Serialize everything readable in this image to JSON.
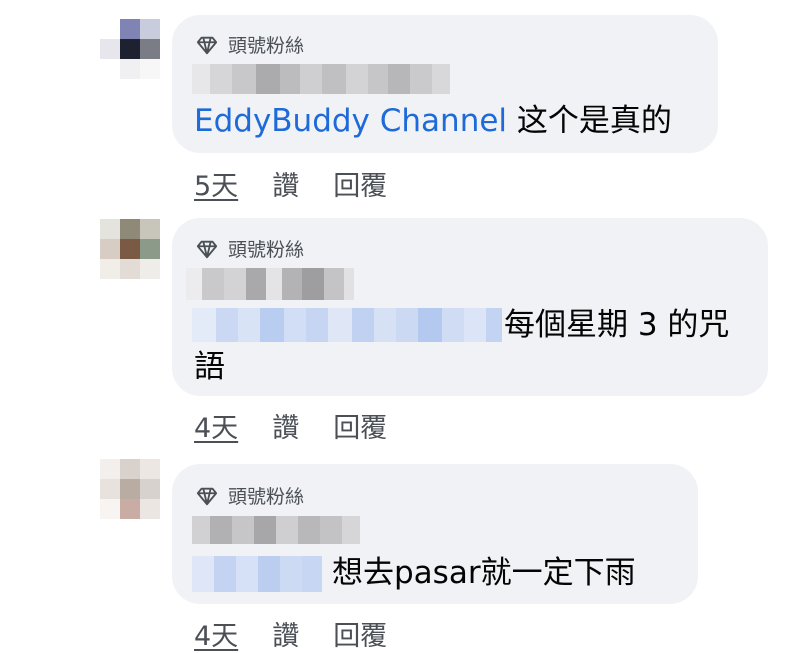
{
  "comments": [
    {
      "badge": "頭號粉絲",
      "mention": "EddyBuddy Channel",
      "text": "这个是真的",
      "time": "5天",
      "like": "讚",
      "reply": "回覆"
    },
    {
      "badge": "頭號粉絲",
      "text_line1": "每個星期 3 的咒",
      "text_line2": "語",
      "time": "4天",
      "like": "讚",
      "reply": "回覆"
    },
    {
      "badge": "頭號粉絲",
      "text": "想去pasar就一定下雨",
      "time": "4天",
      "like": "讚",
      "reply": "回覆"
    }
  ],
  "colors": {
    "bubble": "#f0f2f5",
    "link": "#1d6ad8",
    "meta_text": "#4b4f56"
  }
}
